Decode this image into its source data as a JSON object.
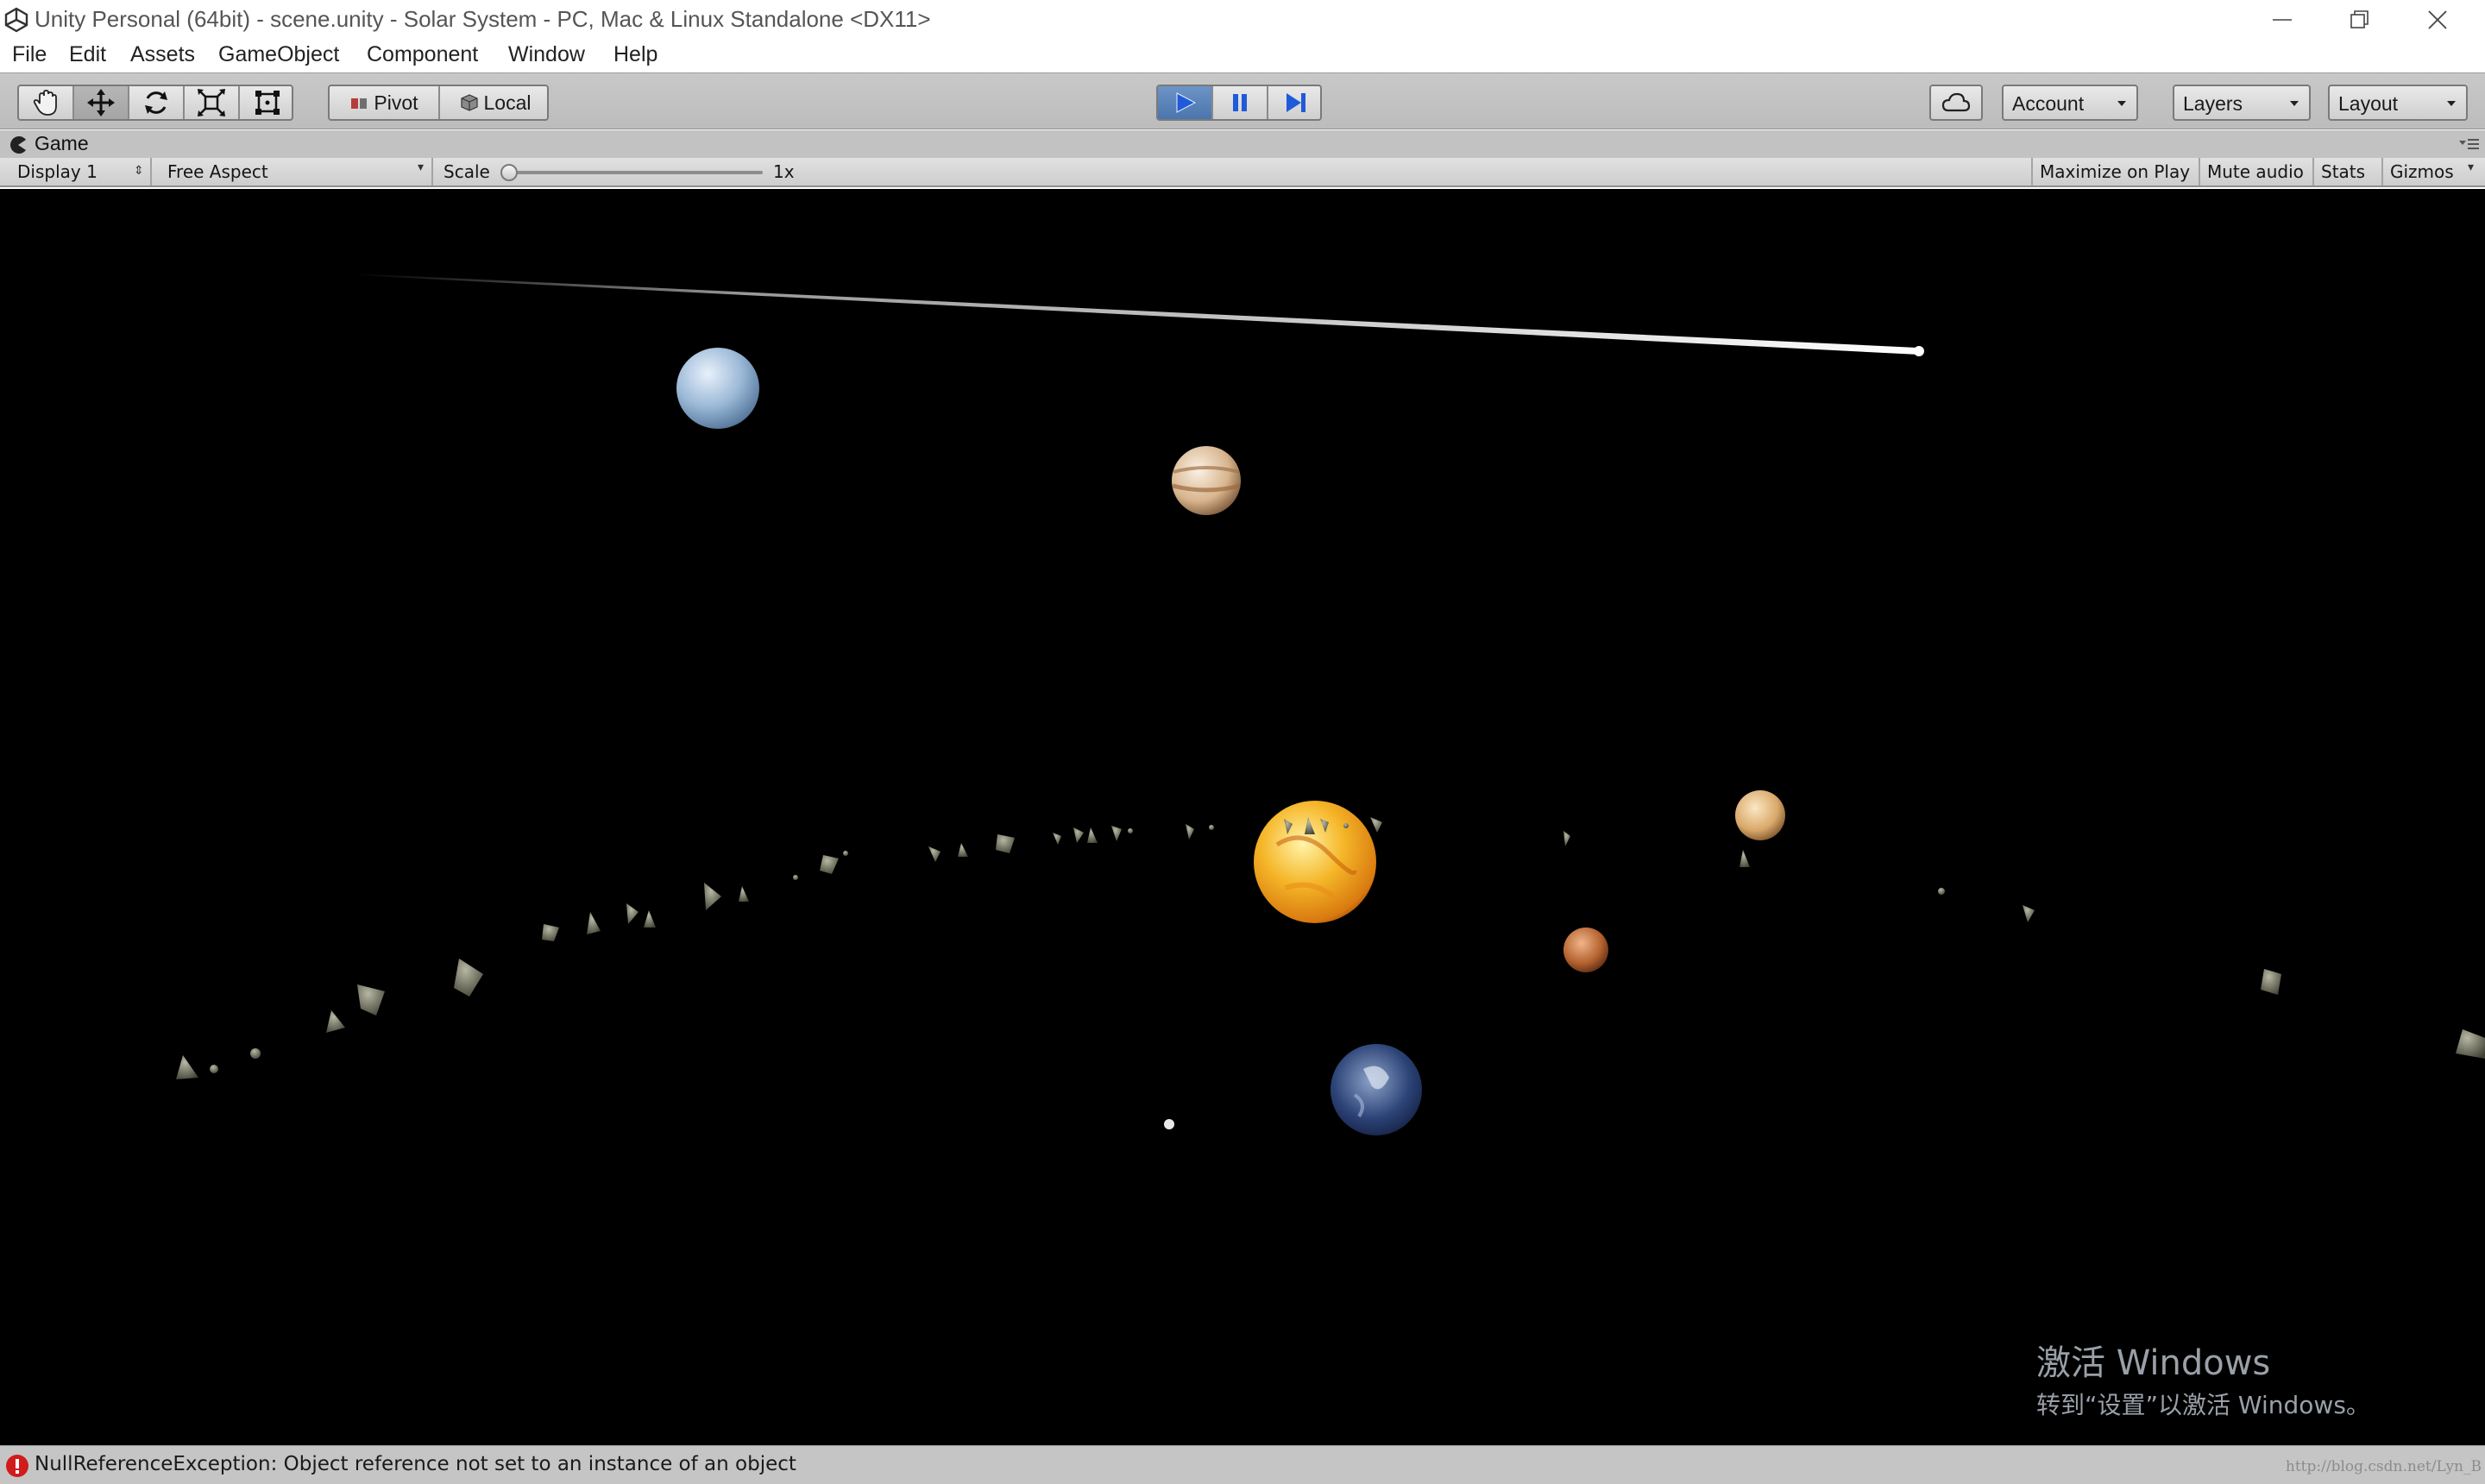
{
  "window": {
    "title": "Unity Personal (64bit) - scene.unity - Solar System - PC, Mac & Linux Standalone <DX11>"
  },
  "menu": {
    "items": [
      "File",
      "Edit",
      "Assets",
      "GameObject",
      "Component",
      "Window",
      "Help"
    ]
  },
  "toolbar": {
    "transform_tools": [
      "hand-icon",
      "move-icon",
      "rotate-icon",
      "scale-icon",
      "rect-icon"
    ],
    "pivot_label": "Pivot",
    "local_label": "Local",
    "account_label": "Account",
    "layers_label": "Layers",
    "layout_label": "Layout"
  },
  "game_view": {
    "tab_label": "Game",
    "display": "Display 1",
    "aspect": "Free Aspect",
    "scale_label": "Scale",
    "scale_value": "1x",
    "maximize_label": "Maximize on Play",
    "mute_label": "Mute audio",
    "stats_label": "Stats",
    "gizmos_label": "Gizmos"
  },
  "watermark": {
    "line1": "激活 Windows",
    "line2": "转到“设置”以激活 Windows。"
  },
  "status": {
    "error_text": "NullReferenceException: Object reference not set to an instance of an object",
    "url_text": "http://blog.csdn.net/Lyn_B"
  },
  "colors": {
    "play_active": "#4a75ad",
    "viewport_bg": "#000000",
    "error_red": "#d01c1c"
  }
}
